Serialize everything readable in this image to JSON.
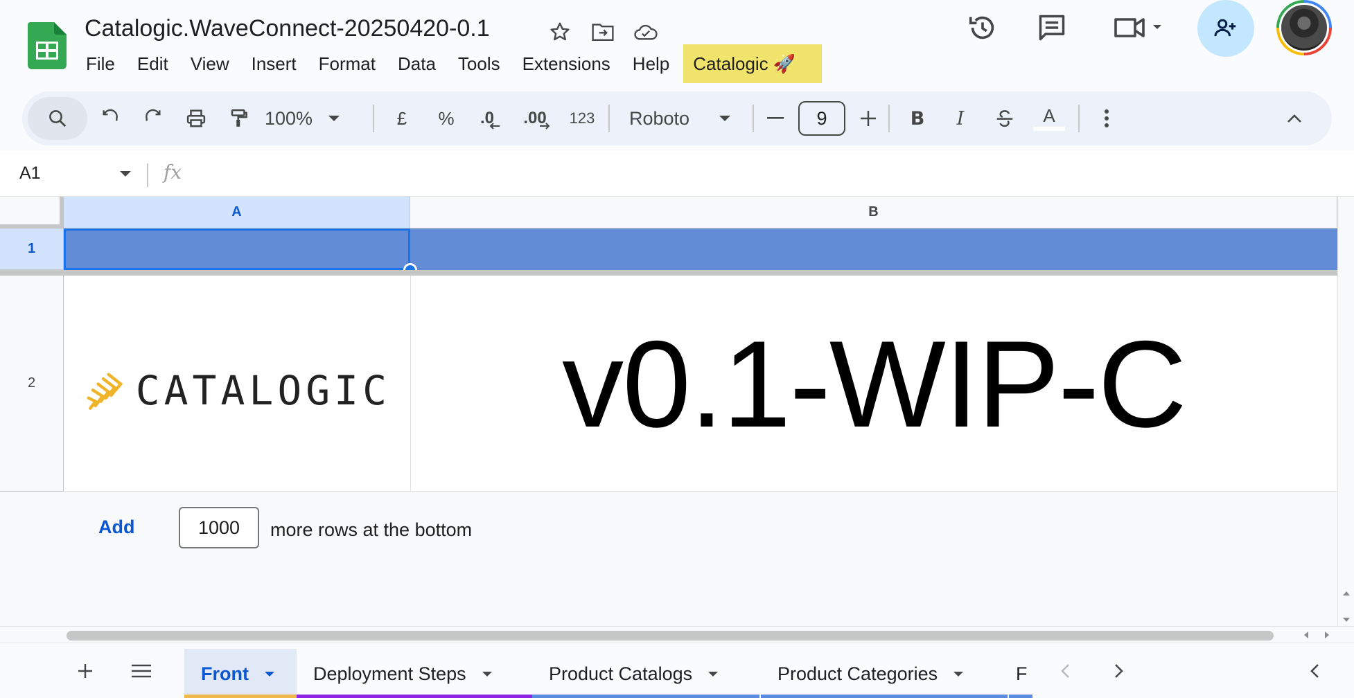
{
  "document": {
    "title": "Catalogic.WaveConnect-20250420-0.1"
  },
  "menu": {
    "items": [
      "File",
      "Edit",
      "View",
      "Insert",
      "Format",
      "Data",
      "Tools",
      "Extensions",
      "Help"
    ],
    "addon_label": "Catalogic 🚀"
  },
  "toolbar": {
    "zoom": "100%",
    "currency": "£",
    "percent": "%",
    "decrease_decimal": ".0",
    "increase_decimal": ".00",
    "number_format": "123",
    "font": "Roboto",
    "font_size": "9",
    "bold": "B",
    "italic": "I",
    "text_color": "A"
  },
  "formula_bar": {
    "cell_ref": "A1",
    "fx": "fx"
  },
  "grid": {
    "columns": [
      "A",
      "B"
    ],
    "rows": [
      "1",
      "2"
    ],
    "selected_cell": "A1",
    "cells": {
      "A2_logo_text": "CATALOGIC",
      "B2": "v0.1-WIP-C"
    },
    "row1_fill_color": "#628dd6"
  },
  "add_rows": {
    "button": "Add",
    "count": "1000",
    "suffix": "more rows at the bottom"
  },
  "sheets": [
    {
      "name": "Front",
      "active": true,
      "color": "#f0b84b"
    },
    {
      "name": "Deployment Steps",
      "active": false,
      "color": "#8e24e8"
    },
    {
      "name": "Product Catalogs",
      "active": false,
      "color": "#5b8be0"
    },
    {
      "name": "Product Categories",
      "active": false,
      "color": "#5b8be0"
    },
    {
      "name": "F",
      "active": false,
      "color": "#5b8be0"
    }
  ],
  "icons": {
    "app": "google-sheets-icon",
    "star": "star-icon",
    "move": "move-to-folder-icon",
    "cloud": "cloud-saved-icon",
    "history": "version-history-icon",
    "comments": "comments-icon",
    "meet": "video-camera-icon",
    "share": "person-add-icon"
  },
  "colors": {
    "accent": "#0b57d0",
    "selection": "#1a73e8",
    "addon_highlight": "#f1e46c",
    "share_button": "#c2e7ff"
  }
}
